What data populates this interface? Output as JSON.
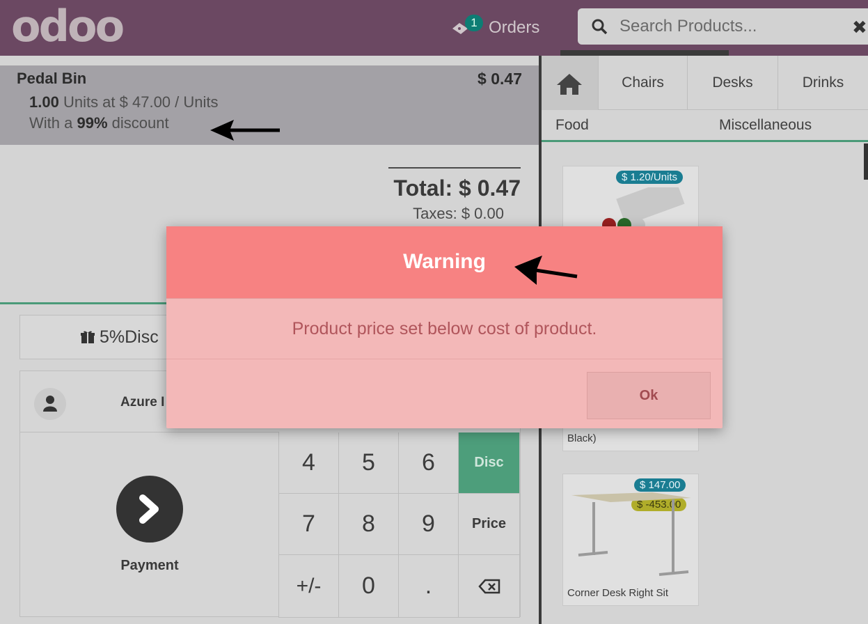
{
  "header": {
    "logo": "odoo",
    "orders_label": "Orders",
    "orders_count": "1",
    "search_placeholder": "Search Products...",
    "icons": [
      "ticket-icon",
      "search-icon",
      "close-icon"
    ]
  },
  "order": {
    "line": {
      "product": "Pedal Bin",
      "price": "$ 0.47",
      "qty": "1.00",
      "qty_suffix": " Units at $ 47.00 / Units",
      "disc_prefix": "With a ",
      "disc_value": "99%",
      "disc_suffix": " discount"
    },
    "total": "Total: $ 0.47",
    "taxes": "Taxes: $ 0.00"
  },
  "controls": {
    "reward_button": "5%Disc",
    "customer": "Azure I",
    "payment": "Payment",
    "keys": {
      "k4": "4",
      "k5": "5",
      "k6": "6",
      "disc": "Disc",
      "k7": "7",
      "k8": "8",
      "k9": "9",
      "price": "Price",
      "pm": "+/-",
      "k0": "0",
      "dot": "."
    }
  },
  "categories": {
    "row1": [
      "Chairs",
      "Desks",
      "Drinks"
    ],
    "row2": [
      "Food",
      "Miscellaneous"
    ]
  },
  "products": [
    {
      "name": "",
      "tag1": "$ 1.20/Units"
    },
    {
      "name": "Black)"
    },
    {
      "name": "Corner Desk Right Sit",
      "tag1": "$ 147.00",
      "tag2": "$ -453.00"
    }
  ],
  "modal": {
    "title": "Warning",
    "message": "Product price set below cost of product.",
    "ok": "Ok"
  },
  "colors": {
    "header": "#6b4862",
    "accent_green": "#4a9a78",
    "modal_head": "#f78282",
    "modal_body": "#f3b8b8"
  }
}
